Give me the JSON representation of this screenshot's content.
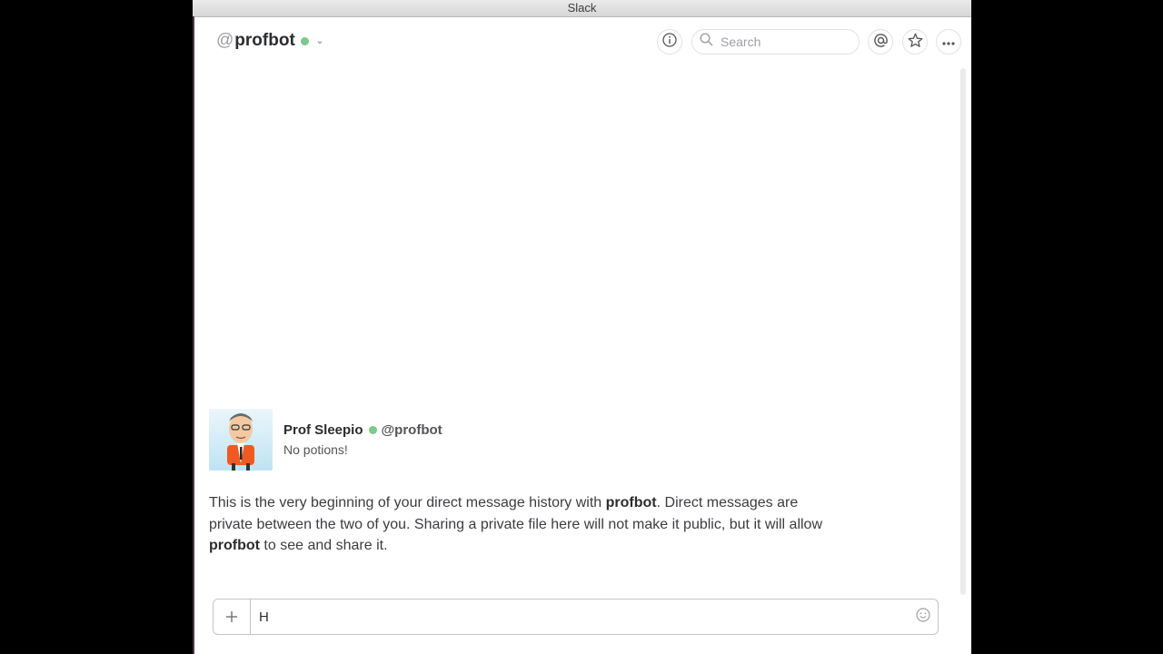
{
  "window": {
    "title": "Slack"
  },
  "header": {
    "at_symbol": "@",
    "channel_name": "profbot",
    "search_placeholder": "Search"
  },
  "intro": {
    "display_name": "Prof Sleepio",
    "handle": "@profbot",
    "status": "No potions!",
    "text_part1": "This is the very beginning of your direct message history with ",
    "bold1": "profbot",
    "text_part2": ". Direct messages are private between the two of you. Sharing a private file here will not make it public, but it will allow ",
    "bold2": "profbot",
    "text_part3": " to see and share it."
  },
  "composer": {
    "value": "H"
  },
  "colors": {
    "presence": "#7dc88b",
    "sidebar_edge": "#4d394b"
  },
  "icons": [
    "info-icon",
    "search-icon",
    "mention-icon",
    "star-icon",
    "more-icon",
    "plus-icon",
    "emoji-icon",
    "chevron-down-icon"
  ]
}
